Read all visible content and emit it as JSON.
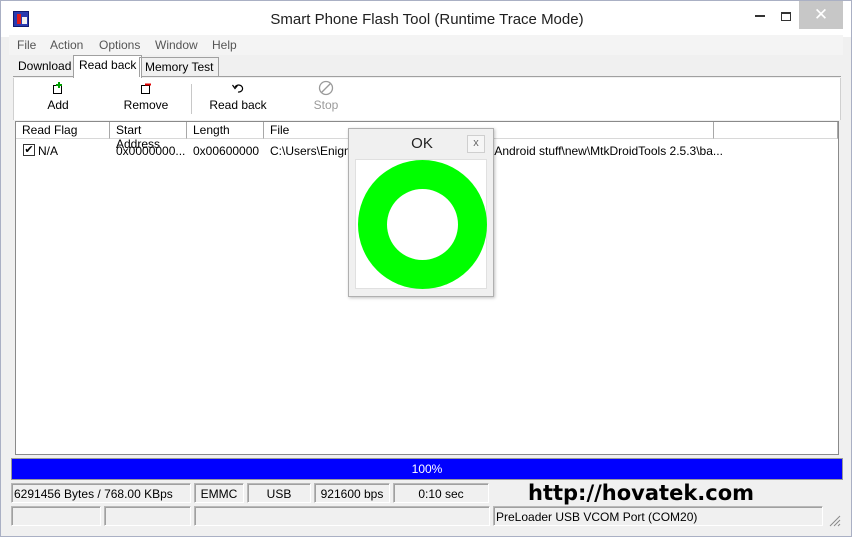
{
  "window": {
    "title": "Smart Phone Flash Tool (Runtime Trace Mode)",
    "close_glyph": "✕"
  },
  "menu": [
    "File",
    "Action",
    "Options",
    "Window",
    "Help"
  ],
  "tabs": [
    {
      "label": "Download",
      "active": false
    },
    {
      "label": "Read back",
      "active": true
    },
    {
      "label": "Memory Test",
      "active": false
    }
  ],
  "toolbar": {
    "add": "Add",
    "remove": "Remove",
    "read_back": "Read back",
    "stop": "Stop"
  },
  "table": {
    "columns": [
      "Read Flag",
      "Start Address",
      "Length",
      "File"
    ],
    "rows": [
      {
        "checked": true,
        "check_glyph": "✔",
        "read_flag": "N/A",
        "start_address": "0x0000000...",
        "length": "0x00600000",
        "file_left": "C:\\Users\\Enigm",
        "file_right": "\\Android stuff\\new\\MtkDroidTools 2.5.3\\ba..."
      }
    ]
  },
  "popup": {
    "title": "OK",
    "close": "x",
    "ring_color": "#00ff00"
  },
  "progress": {
    "percent": 100,
    "label": "100%",
    "color": "#0000ff"
  },
  "status": {
    "transfer": "6291456 Bytes / 768.00 KBps",
    "storage": "EMMC",
    "connection": "USB",
    "baud": "921600 bps",
    "elapsed": "0:10 sec",
    "port": "PreLoader USB VCOM Port (COM20)"
  },
  "watermark": "http://hovatek.com"
}
